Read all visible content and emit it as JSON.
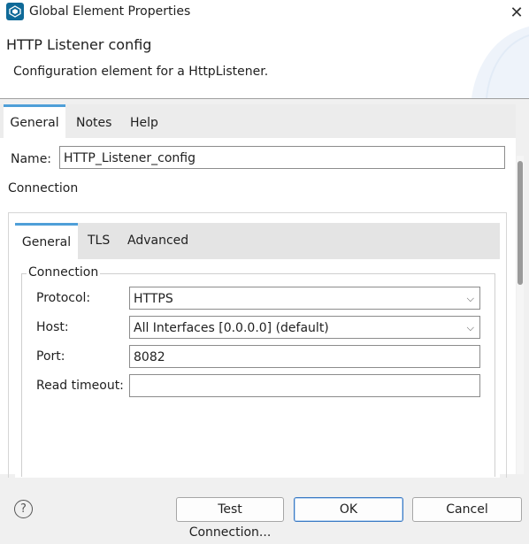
{
  "window": {
    "title": "Global Element Properties",
    "close_glyph": "✕"
  },
  "header": {
    "title": "HTTP Listener config",
    "description": "Configuration element for a HttpListener."
  },
  "outer_tabs": [
    {
      "label": "General",
      "active": true
    },
    {
      "label": "Notes",
      "active": false
    },
    {
      "label": "Help",
      "active": false
    }
  ],
  "form": {
    "name_label": "Name:",
    "name_value": "HTTP_Listener_config",
    "connection_label": "Connection"
  },
  "inner_tabs": [
    {
      "label": "General",
      "active": true
    },
    {
      "label": "TLS",
      "active": false
    },
    {
      "label": "Advanced",
      "active": false
    }
  ],
  "connection": {
    "legend": "Connection",
    "protocol_label": "Protocol:",
    "protocol_value": "HTTPS",
    "host_label": "Host:",
    "host_value": "All Interfaces [0.0.0.0] (default)",
    "port_label": "Port:",
    "port_value": "8082",
    "read_timeout_label": "Read timeout:",
    "read_timeout_value": ""
  },
  "footer": {
    "help_glyph": "?",
    "test_connection_label": "Test Connection...",
    "ok_label": "OK",
    "cancel_label": "Cancel"
  },
  "icons": {
    "app": "app-logo-icon",
    "close": "close-icon",
    "dropdown": "chevron-down-icon",
    "help": "help-icon"
  },
  "colors": {
    "accent_tab": "#4f9fd8",
    "app_icon": "#0f6a98"
  }
}
